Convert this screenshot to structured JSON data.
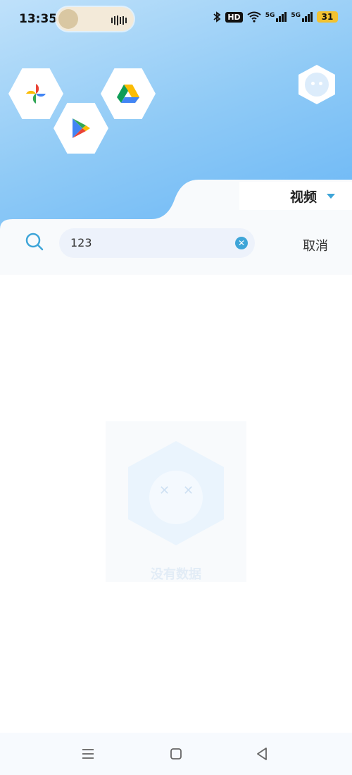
{
  "status_bar": {
    "time": "13:35",
    "icons": [
      "bluetooth-icon",
      "hd-icon",
      "wifi-icon",
      "signal-5g-icon",
      "signal-5g-icon"
    ],
    "hd_label": "HD",
    "network_label_1": "5G",
    "network_label_2": "5G",
    "battery": "31",
    "battery_color": "#f2c230"
  },
  "header": {
    "apps": [
      {
        "name": "Google Photos",
        "icon": "pinwheel-icon"
      },
      {
        "name": "Google Drive",
        "icon": "drive-triangle-icon"
      },
      {
        "name": "Google Play",
        "icon": "play-triangle-icon"
      }
    ],
    "avatar_icon": "robot-avatar-icon"
  },
  "filter": {
    "selected": "视频"
  },
  "search": {
    "value": "123",
    "cancel_label": "取消"
  },
  "empty_state": {
    "text": "没有数据"
  },
  "nav": {
    "buttons": [
      "menu-icon",
      "home-icon",
      "back-icon"
    ]
  },
  "colors": {
    "accent": "#3ea5d8",
    "header_gradient_end": "#5fb1f5"
  }
}
